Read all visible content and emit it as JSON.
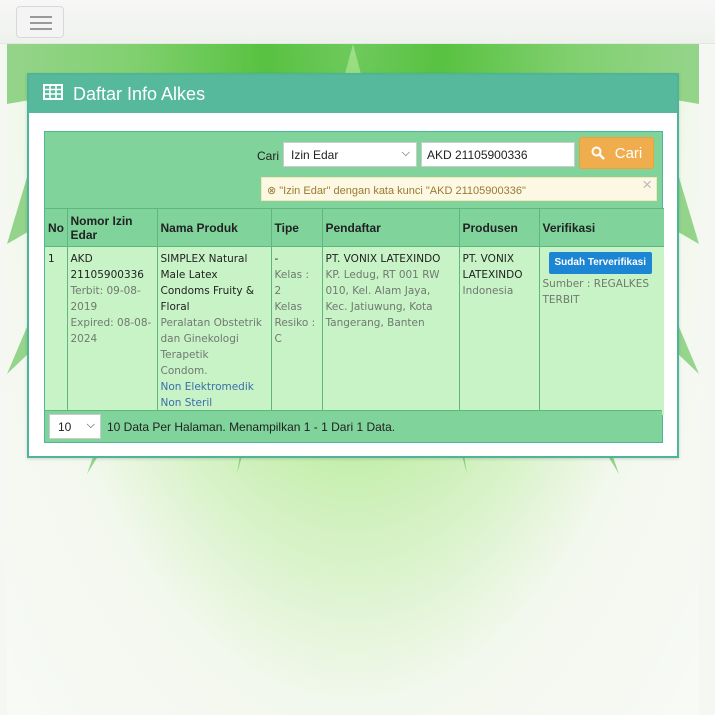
{
  "panel": {
    "title": "Daftar Info Alkes"
  },
  "search": {
    "label": "Cari",
    "field_selected": "Izin Edar",
    "query_value": "AKD 21105900336",
    "button_label": "Cari",
    "info_text": "\"Izin Edar\" dengan kata kunci \"AKD 21105900336\""
  },
  "table": {
    "headers": {
      "no": "No",
      "nomor": "Nomor Izin Edar",
      "nama": "Nama Produk",
      "tipe": "Tipe",
      "pendaftar": "Pendaftar",
      "produsen": "Produsen",
      "verifikasi": "Verifikasi"
    },
    "rows": [
      {
        "no": "1",
        "nomor": "AKD 21105900336",
        "terbit": "Terbit: 09-08-2019",
        "expired": "Expired: 08-08-2024",
        "nama": "SIMPLEX Natural Male Latex Condoms Fruity & Floral",
        "kategori": "Peralatan Obstetrik dan Ginekologi Terapetik",
        "subkategori": "Condom.",
        "elektromedik": "Non Elektromedik",
        "steril": "Non Steril",
        "tipe_dash": "-",
        "tipe_kelas": "Kelas : 2",
        "tipe_resiko": "Kelas Resiko : C",
        "pendaftar_nama": "PT. VONIX LATEXINDO",
        "pendaftar_alamat": "KP. Ledug, RT 001 RW 010, Kel. Alam Jaya, Kec. Jatiuwung, Kota Tangerang, Banten",
        "produsen_nama": "PT. VONIX LATEXINDO",
        "produsen_negara": "Indonesia",
        "verifikasi_badge": "Sudah Terverifikasi",
        "verifikasi_sumber": "Sumber : REGALKES TERBIT"
      }
    ]
  },
  "footer": {
    "per_page": "10",
    "summary": "10 Data Per Halaman. Menampilkan 1 - 1 Dari 1 Data."
  },
  "colors": {
    "panel_header": "#56b99b",
    "table_header": "#7fd39b",
    "table_body": "#c8f3c6",
    "search_button": "#f0ad4e",
    "badge": "#1d86d4"
  },
  "icons": [
    "menu-icon",
    "table-icon",
    "search-icon",
    "close-icon",
    "remove-circle-icon",
    "chevron-down-icon"
  ]
}
